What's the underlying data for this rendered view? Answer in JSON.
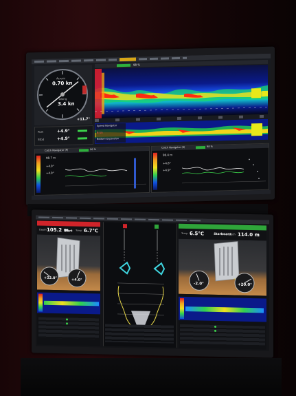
{
  "upper_monitor": {
    "gauge": {
      "across_label": "Across",
      "across_value": "0.70 kn",
      "along_label": "Along",
      "along_value": "3.4 kn",
      "bottom_value": "+11.7°"
    },
    "temp_readings": [
      {
        "label": "Port",
        "value": "+4.9°"
      },
      {
        "label": "Stbd",
        "value": "+4.9°"
      }
    ],
    "echo_header_value": "98 %",
    "lower_echo_labels": [
      "Speed Navigator",
      "6 kn",
      "Bottom Expansion"
    ],
    "catch_left": {
      "title": "Catch Navigator (P)",
      "badge": "98 %",
      "depth": "98.7 m",
      "readings": [
        "+4.9°",
        "+4.9°"
      ]
    },
    "catch_right": {
      "title": "Catch Navigator (S)",
      "badge": "98 %",
      "depth": "98.4 m",
      "readings": [
        "+4.8°",
        "+4.9°"
      ]
    }
  },
  "lower_monitor": {
    "port": {
      "title": "Port",
      "depth_label": "Depth",
      "depth_value": "105.2 m",
      "temp_label": "Temp",
      "temp_value": "6.7°C",
      "left_gauge": "+22.0°",
      "right_gauge": "+4.0°"
    },
    "starboard": {
      "title": "Starboard",
      "temp_label": "Temp",
      "temp_value": "6.5°C",
      "depth_label": "Depth",
      "depth_value": "114.0 m",
      "left_gauge": "-2.0°",
      "right_gauge": "+20.0°"
    }
  },
  "colors": {
    "port_header": "#d0242a",
    "starboard_header": "#2fa53a",
    "echo_deep": "#0a1a8a",
    "echo_hot": "#ff2a10",
    "gauge_needle": "#e8e8e8"
  }
}
